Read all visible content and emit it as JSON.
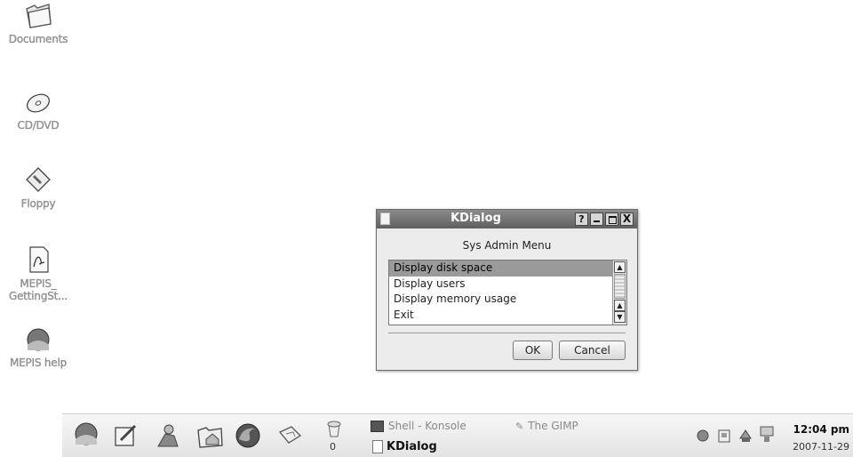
{
  "desktop": {
    "icons": [
      {
        "label": "Documents"
      },
      {
        "label": "CD/DVD"
      },
      {
        "label": "Floppy"
      },
      {
        "label_line1": "MEPIS_",
        "label_line2": "GettingSt..."
      },
      {
        "label": "MEPIS help"
      }
    ]
  },
  "dialog": {
    "title": "KDialog",
    "heading": "Sys Admin Menu",
    "items": [
      {
        "label": "Display disk space",
        "selected": true
      },
      {
        "label": "Display users"
      },
      {
        "label": "Display memory usage"
      },
      {
        "label": "Exit"
      }
    ],
    "titlebar_buttons": {
      "help": "?",
      "close": "X"
    },
    "ok_label": "OK",
    "cancel_label": "Cancel"
  },
  "taskbar": {
    "launchers": [
      "kmenu-icon",
      "notes-icon",
      "user-icon",
      "home-folder-icon",
      "firefox-icon",
      "puzzle-icon"
    ],
    "trash_count": "0",
    "tasks": [
      {
        "label": "Shell - Konsole",
        "icon": "terminal-icon"
      },
      {
        "label": "The GIMP",
        "icon": "gimp-icon"
      },
      {
        "label": "KDialog",
        "icon": "document-icon",
        "active": true
      }
    ],
    "clock": {
      "time": "12:04 pm",
      "date": "2007-11-29"
    }
  },
  "colors": {
    "titlebar": "#6f6f6f",
    "selection": "#9a9a9a",
    "desktop_bg": "#ffffff"
  }
}
